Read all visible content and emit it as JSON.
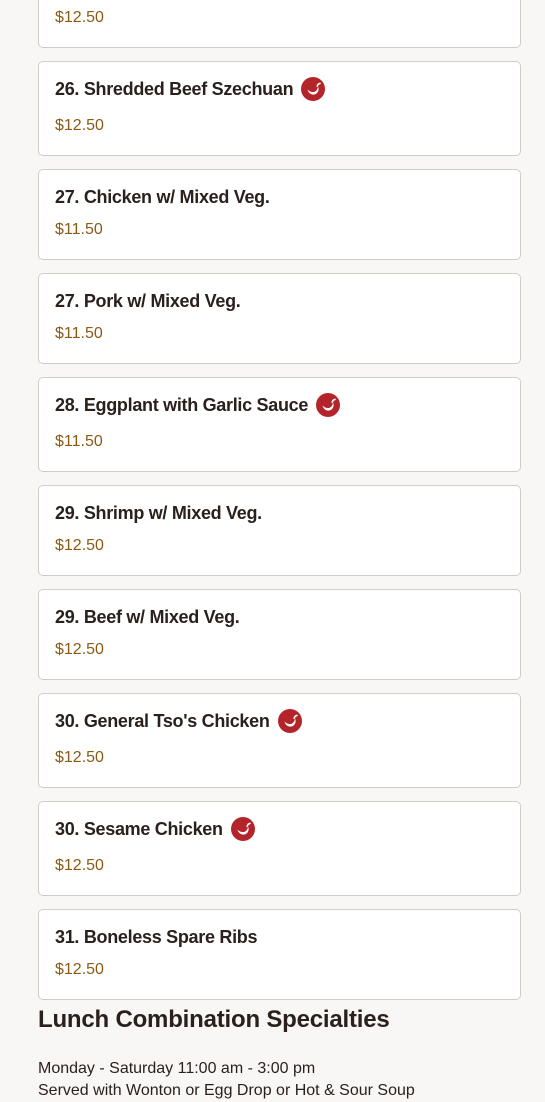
{
  "items": [
    {
      "name": "",
      "price": "$12.50",
      "spicy": false
    },
    {
      "name": "26. Shredded Beef Szechuan",
      "price": "$12.50",
      "spicy": true
    },
    {
      "name": "27. Chicken w/ Mixed Veg.",
      "price": "$11.50",
      "spicy": false
    },
    {
      "name": "27. Pork w/ Mixed Veg.",
      "price": "$11.50",
      "spicy": false
    },
    {
      "name": "28. Eggplant with Garlic Sauce",
      "price": "$11.50",
      "spicy": true
    },
    {
      "name": "29. Shrimp w/ Mixed Veg.",
      "price": "$12.50",
      "spicy": false
    },
    {
      "name": "29. Beef w/ Mixed Veg.",
      "price": "$12.50",
      "spicy": false
    },
    {
      "name": "30. General Tso's Chicken",
      "price": "$12.50",
      "spicy": true
    },
    {
      "name": "30. Sesame Chicken",
      "price": "$12.50",
      "spicy": true
    },
    {
      "name": "31. Boneless Spare Ribs",
      "price": "$12.50",
      "spicy": false
    }
  ],
  "section": {
    "title": "Lunch Combination Specialties",
    "hours": "Monday - Saturday 11:00 am - 3:00 pm",
    "served": "Served with Wonton or Egg Drop or Hot & Sour Soup"
  },
  "icons": {
    "spicy": "chili-pepper-icon"
  },
  "colors": {
    "background": "#f9f7f5",
    "card": "#ffffff",
    "border": "#d2ccc6",
    "text": "#2a211d",
    "price": "#8a5a14",
    "spicy": "#b3252a"
  }
}
